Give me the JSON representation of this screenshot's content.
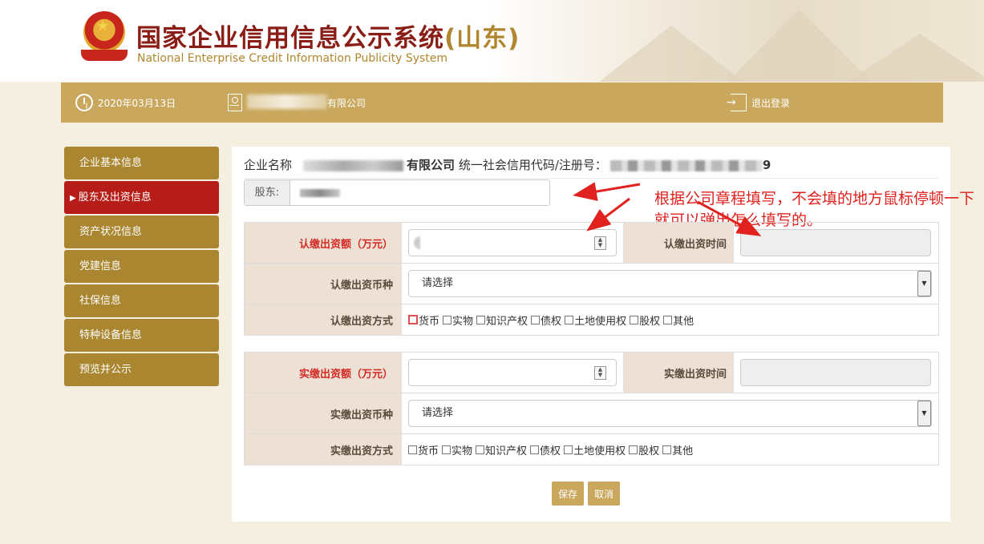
{
  "header": {
    "title_main": "国家企业信用信息公示系统",
    "title_region": "(山东)",
    "subtitle": "National Enterprise Credit Information Publicity System"
  },
  "topbar": {
    "date": "2020年03月13日",
    "company_suffix": "有限公司",
    "logout": "退出登录"
  },
  "sidebar": {
    "items": [
      {
        "label": "企业基本信息"
      },
      {
        "label": "股东及出资信息"
      },
      {
        "label": "资产状况信息"
      },
      {
        "label": "党建信息"
      },
      {
        "label": "社保信息"
      },
      {
        "label": "特种设备信息"
      },
      {
        "label": "预览并公示"
      }
    ],
    "active_index": 1
  },
  "main": {
    "company_label": "企业名称",
    "company_name_suffix": "有限公司",
    "credit_code_label": "统一社会信用代码/注册号：",
    "credit_code_tail": "9",
    "shareholder_label": "股东:",
    "annotation": "根据公司章程填写，不会填的地方鼠标停顿一下就可以弹出怎么填写的。",
    "subscribed": {
      "amount_label": "认缴出资额（万元）",
      "time_label": "认缴出资时间",
      "currency_label": "认缴出资币种",
      "currency_value": "请选择",
      "method_label": "认缴出资方式"
    },
    "paid": {
      "amount_label": "实缴出资额（万元）",
      "time_label": "实缴出资时间",
      "currency_label": "实缴出资币种",
      "currency_value": "请选择",
      "method_label": "实缴出资方式"
    },
    "methods": [
      "货币",
      "实物",
      "知识产权",
      "债权",
      "土地使用权",
      "股权",
      "其他"
    ],
    "save_label": "保存",
    "cancel_label": "取消"
  }
}
